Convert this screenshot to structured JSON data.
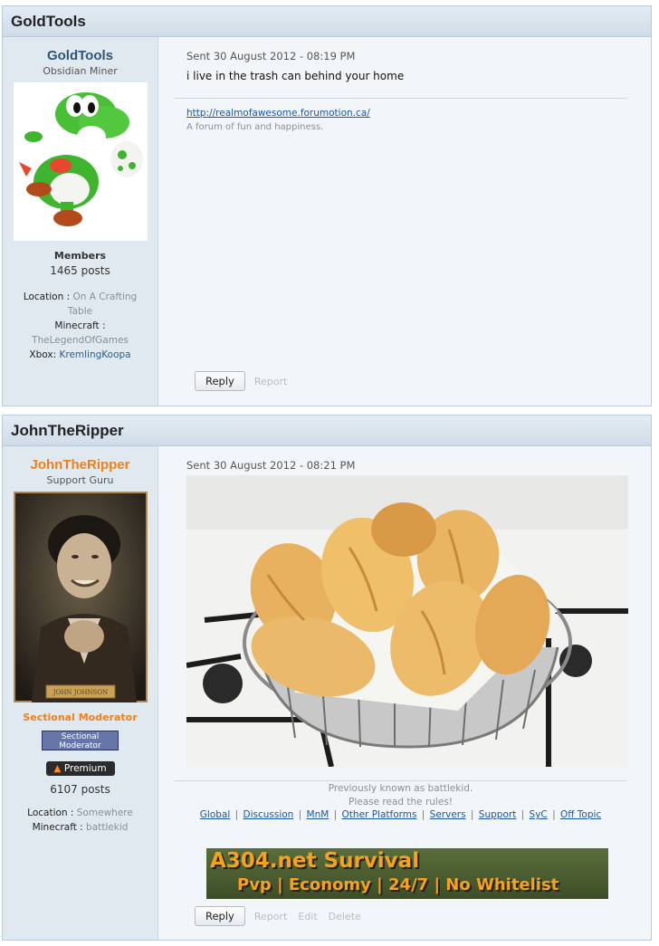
{
  "posts": [
    {
      "header": "GoldTools",
      "username": "GoldTools",
      "rank": "Obsidian Miner",
      "group": "Members",
      "post_count": "1465 posts",
      "fields": [
        {
          "label": "Location",
          "value": "On A Crafting Table"
        },
        {
          "label": "Minecraft",
          "value": "TheLegendOfGames"
        },
        {
          "label": "Xbox",
          "value": "KremlingKoopa"
        }
      ],
      "sent": "Sent 30 August 2012 - 08:19 PM",
      "message": "i live in the trash can behind your home",
      "sig_link": "http://realmofawesome.forumotion.ca/",
      "sig_text": "A forum of fun and happiness.",
      "reply": "Reply",
      "report": "Report"
    },
    {
      "header": "JohnTheRipper",
      "username": "JohnTheRipper",
      "rank": "Support Guru",
      "plate": "JOHN JOHNSON",
      "group": "Sectional Moderator",
      "mod_badge": "Sectional Moderator",
      "premium": "Premium",
      "post_count": "6107 posts",
      "fields": [
        {
          "label": "Location",
          "value": "Somewhere"
        },
        {
          "label": "Minecraft",
          "value": "battlekid"
        }
      ],
      "sent": "Sent 30 August 2012 - 08:21 PM",
      "sig_line1": "Previously known as battlekid.",
      "sig_line2": "Please read the rules!",
      "sig_links": [
        "Global",
        "Discussion",
        "MnM",
        "Other Platforms",
        "Servers",
        "Support",
        "SyC",
        "Off Topic"
      ],
      "banner_title": "A304.net Survival",
      "banner_sub": "Pvp | Economy | 24/7 | No Whitelist",
      "reply": "Reply",
      "report": "Report",
      "edit": "Edit",
      "delete": "Delete"
    }
  ],
  "colors": {
    "username1": "#2d5479",
    "username2": "#f07f17",
    "mod_group": "#f07f17"
  }
}
